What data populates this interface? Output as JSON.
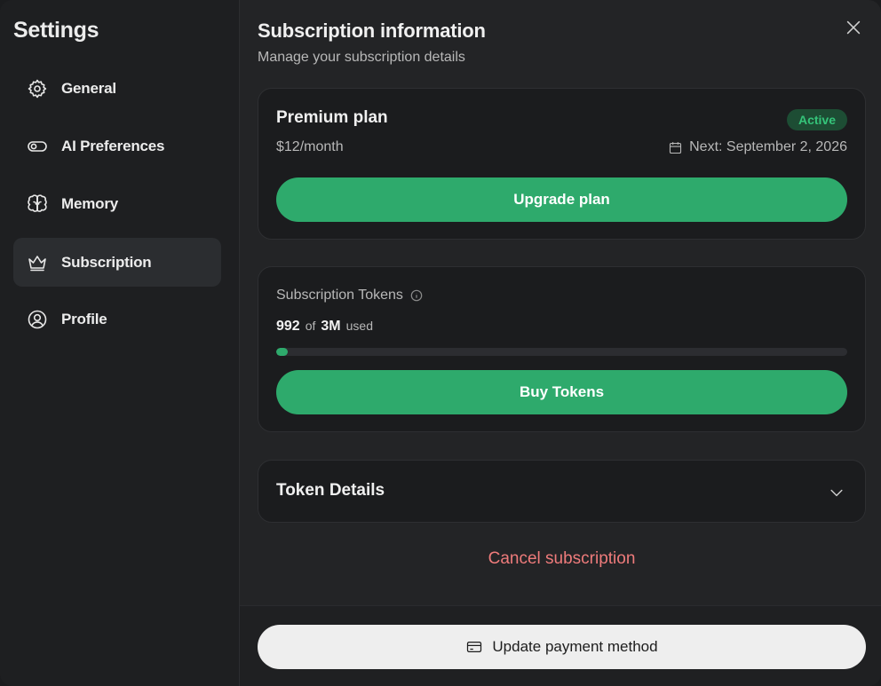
{
  "sidebar": {
    "title": "Settings",
    "items": [
      {
        "label": "General",
        "icon": "gear-icon"
      },
      {
        "label": "AI Preferences",
        "icon": "toggle-icon"
      },
      {
        "label": "Memory",
        "icon": "brain-icon"
      },
      {
        "label": "Subscription",
        "icon": "crown-icon",
        "active": true
      },
      {
        "label": "Profile",
        "icon": "user-circle-icon"
      }
    ]
  },
  "header": {
    "title": "Subscription information",
    "subtitle": "Manage your subscription details"
  },
  "plan": {
    "name": "Premium plan",
    "status": "Active",
    "price": "$12/month",
    "next_billing": "Next: September 2, 2026",
    "upgrade_label": "Upgrade plan"
  },
  "tokens": {
    "label": "Subscription Tokens",
    "used": "992",
    "of_label": "of",
    "total": "3M",
    "used_label": "used",
    "progress_percent": 2,
    "buy_label": "Buy Tokens"
  },
  "details": {
    "label": "Token Details"
  },
  "cancel_label": "Cancel subscription",
  "footer": {
    "payment_label": "Update payment method"
  },
  "colors": {
    "accent_green": "#2eaa6c",
    "badge_green": "#35c47a",
    "danger": "#ee7b7b"
  }
}
